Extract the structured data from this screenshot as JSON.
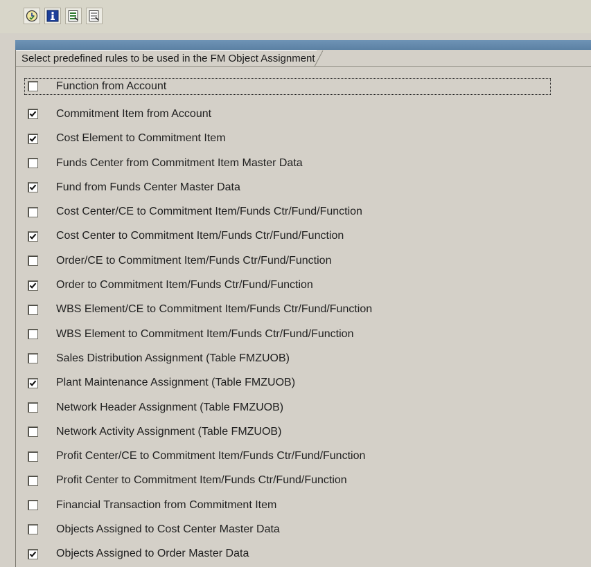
{
  "toolbar": {
    "buttons": [
      {
        "icon": "execute-clock-icon"
      },
      {
        "icon": "info-icon"
      },
      {
        "icon": "select-all-icon"
      },
      {
        "icon": "deselect-all-icon"
      }
    ]
  },
  "frame": {
    "title": "Select  predefined rules to be used in the FM Object  Assignment"
  },
  "rules": [
    {
      "label": "Function from Account",
      "checked": false
    },
    {
      "label": "Commitment Item from Account",
      "checked": true
    },
    {
      "label": "Cost Element to Commitment Item",
      "checked": true
    },
    {
      "label": "Funds Center from Commitment Item Master Data",
      "checked": false
    },
    {
      "label": "Fund from Funds Center Master Data",
      "checked": true
    },
    {
      "label": "Cost Center/CE to Commitment Item/Funds Ctr/Fund/Function",
      "checked": false
    },
    {
      "label": "Cost Center to Commitment Item/Funds Ctr/Fund/Function",
      "checked": true
    },
    {
      "label": "Order/CE to Commitment Item/Funds Ctr/Fund/Function",
      "checked": false
    },
    {
      "label": "Order to Commitment Item/Funds Ctr/Fund/Function",
      "checked": true
    },
    {
      "label": "WBS Element/CE to Commitment Item/Funds Ctr/Fund/Function",
      "checked": false
    },
    {
      "label": "WBS Element to Commitment Item/Funds Ctr/Fund/Function",
      "checked": false
    },
    {
      "label": "Sales Distribution  Assignment (Table FMZUOB)",
      "checked": false
    },
    {
      "label": "Plant Maintenance  Assignment (Table FMZUOB)",
      "checked": true
    },
    {
      "label": "Network Header Assignment (Table FMZUOB)",
      "checked": false
    },
    {
      "label": "Network Activity Assignment (Table FMZUOB)",
      "checked": false
    },
    {
      "label": "Profit Center/CE to Commitment Item/Funds Ctr/Fund/Function",
      "checked": false
    },
    {
      "label": "Profit Center to Commitment Item/Funds Ctr/Fund/Function",
      "checked": false
    },
    {
      "label": "Financial Transaction from Commitment Item",
      "checked": false
    },
    {
      "label": "Objects Assigned to Cost Center Master Data",
      "checked": false
    },
    {
      "label": "Objects Assigned to Order Master Data",
      "checked": true
    }
  ],
  "colors": {
    "background": "#d4d0c8",
    "title_bar": "#6e93b5",
    "toolbar_bg": "#d8d6c9"
  }
}
